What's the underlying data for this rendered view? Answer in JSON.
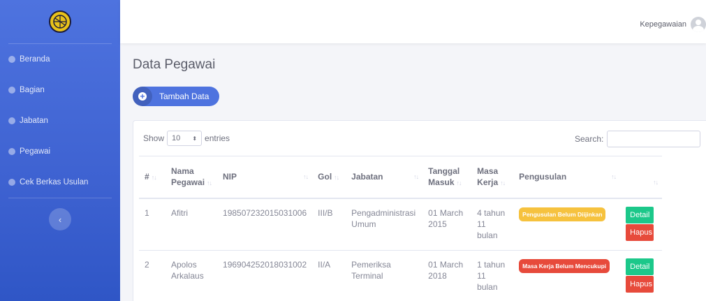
{
  "sidebar": {
    "items": [
      {
        "label": "Beranda"
      },
      {
        "label": "Bagian"
      },
      {
        "label": "Jabatan"
      },
      {
        "label": "Pegawai"
      },
      {
        "label": "Cek Berkas Usulan"
      }
    ],
    "toggle_symbol": "‹"
  },
  "topbar": {
    "user_name": "Kepegawaian"
  },
  "page": {
    "title": "Data Pegawai",
    "add_label": "Tambah Data"
  },
  "table_controls": {
    "show_label": "Show",
    "entries_value": "10",
    "entries_label": "entries",
    "search_label": "Search:",
    "search_value": ""
  },
  "table": {
    "headers": [
      "#",
      "Nama Pegawai",
      "NIP",
      "Gol",
      "Jabatan",
      "Tanggal Masuk",
      "Masa Kerja",
      "Pengusulan",
      ""
    ],
    "rows": [
      {
        "no": "1",
        "nama": "Afitri",
        "nip": "198507232015031006",
        "gol": "III/B",
        "jabatan": "Pengadministrasi Umum",
        "tanggal": "01 March 2015",
        "masa": "4 tahun 11 bulan",
        "pengusulan": "Pengusulan Belum Diijinkan",
        "detail": "Detail",
        "hapus": "Hapus"
      },
      {
        "no": "2",
        "nama": "Apolos Arkalaus",
        "nip": "196904252018031002",
        "gol": "II/A",
        "jabatan": "Pemeriksa Terminal",
        "tanggal": "01 March 2018",
        "masa": "1 tahun 11 bulan",
        "pengusulan": "Masa Kerja Belum Mencukupi",
        "detail": "Detail",
        "hapus": "Hapus"
      }
    ]
  },
  "colors": {
    "primary": "#4e73df",
    "success": "#1cc88a",
    "danger": "#e74a3b",
    "warning": "#f6c23e"
  }
}
